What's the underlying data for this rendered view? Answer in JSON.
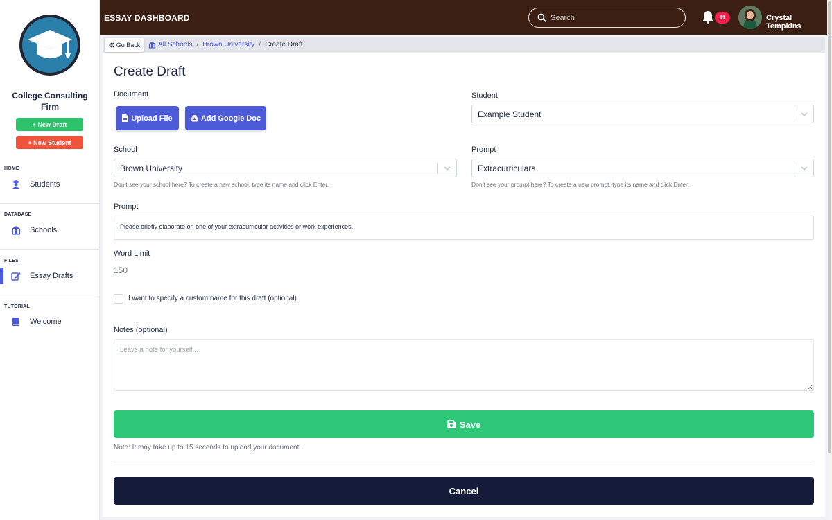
{
  "sidebar": {
    "org_name": "College Consulting Firm",
    "new_draft": "+ New Draft",
    "new_student": "+ New Student",
    "sections": [
      {
        "label": "HOME",
        "item": "Students",
        "icon": "student-icon"
      },
      {
        "label": "DATABASE",
        "item": "Schools",
        "icon": "school-icon"
      },
      {
        "label": "FILES",
        "item": "Essay Drafts",
        "icon": "edit-icon",
        "active": true
      },
      {
        "label": "TUTORIAL",
        "item": "Welcome",
        "icon": "book-icon"
      }
    ]
  },
  "topbar": {
    "title": "ESSAY DASHBOARD",
    "search_placeholder": "Search",
    "notification_count": "11",
    "user_name": "Crystal Tempkins"
  },
  "breadcrumb": {
    "go_back": "Go Back",
    "items": [
      "All Schools",
      "Brown University"
    ],
    "current": "Create Draft"
  },
  "form": {
    "title": "Create Draft",
    "document_label": "Document",
    "upload_file": "Upload File",
    "add_google_doc": "Add Google Doc",
    "student_label": "Student",
    "student_value": "Example Student",
    "school_label": "School",
    "school_value": "Brown University",
    "school_hint": "Don't see your school here? To create a new school, type its name and click Enter.",
    "prompt_select_label": "Prompt",
    "prompt_select_value": "Extracurriculars",
    "prompt_hint": "Don't see your prompt here? To create a new prompt, type its name and click Enter.",
    "prompt_label": "Prompt",
    "prompt_text": "Please briefly elaborate on one of your extracurricular activities or work experiences.",
    "word_limit_label": "Word Limit",
    "word_limit_value": "150",
    "custom_name_label": "I want to specify a custom name for this draft (optional)",
    "notes_label": "Notes (optional)",
    "notes_placeholder": "Leave a note for yourself...",
    "save": "Save",
    "note": "Note: It may take up to 15 seconds to upload your document.",
    "cancel": "Cancel"
  },
  "colors": {
    "topbar": "#3a1f12",
    "accent": "#4e5bd9",
    "save": "#2ec777",
    "new_student": "#f0533b",
    "cancel": "#151c3a",
    "badge": "#ef1f4b"
  }
}
